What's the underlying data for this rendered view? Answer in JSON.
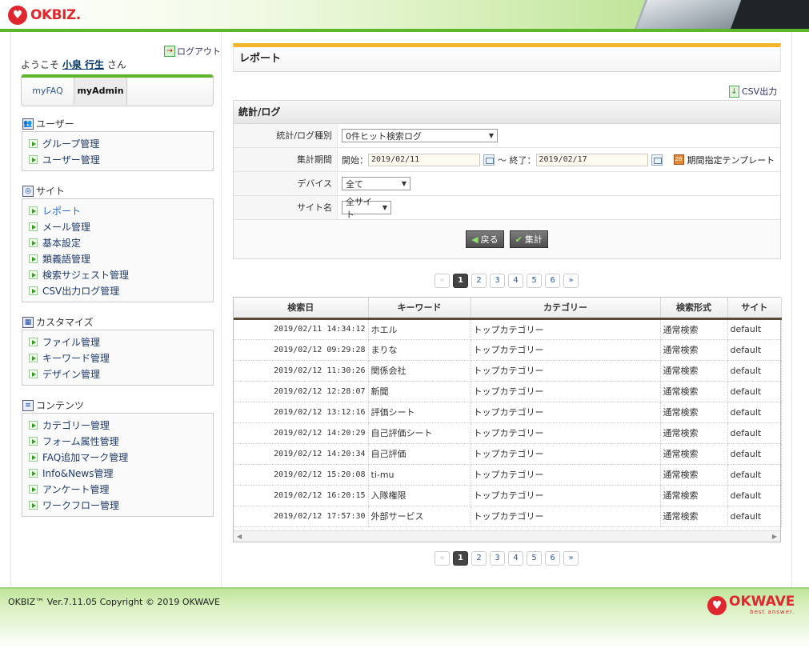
{
  "header": {
    "logo_text": "OKBIZ."
  },
  "sidebar": {
    "logout_label": "ログアウト",
    "welcome_prefix": "ようこそ ",
    "user_name": "小泉 行生",
    "welcome_suffix": " さん",
    "tabs": [
      {
        "label": "myFAQ"
      },
      {
        "label": "myAdmin"
      }
    ],
    "sections": [
      {
        "title": "ユーザー",
        "items": [
          "グループ管理",
          "ユーザー管理"
        ]
      },
      {
        "title": "サイト",
        "items": [
          "レポート",
          "メール管理",
          "基本設定",
          "類義語管理",
          "検索サジェスト管理",
          "CSV出力ログ管理"
        ]
      },
      {
        "title": "カスタマイズ",
        "items": [
          "ファイル管理",
          "キーワード管理",
          "デザイン管理"
        ]
      },
      {
        "title": "コンテンツ",
        "items": [
          "カテゴリー管理",
          "フォーム属性管理",
          "FAQ追加マーク管理",
          "Info&News管理",
          "アンケート管理",
          "ワークフロー管理"
        ]
      }
    ]
  },
  "main": {
    "page_title": "レポート",
    "csv_label": "CSV出力",
    "panel_title": "統計/ログ",
    "form": {
      "type_label": "統計/ログ種別",
      "type_value": "0件ヒット検索ログ",
      "period_label": "集計期間",
      "start_label": "開始：",
      "start_value": "2019/02/11",
      "end_label": "～ 終了：",
      "end_value": "2019/02/17",
      "template_label": "期間指定テンプレート",
      "device_label": "デバイス",
      "device_value": "全て",
      "site_label": "サイト名",
      "site_value": "全サイト"
    },
    "back_button": "戻る",
    "aggregate_button": "集計",
    "pager": {
      "prev": "«",
      "pages": [
        "1",
        "2",
        "3",
        "4",
        "5",
        "6"
      ],
      "next": "»",
      "current": "1"
    },
    "table": {
      "headers": [
        "検索日",
        "キーワード",
        "カテゴリー",
        "検索形式",
        "サイト"
      ],
      "rows": [
        [
          "2019/02/11 14:34:12",
          "ホエル",
          "トップカテゴリー",
          "通常検索",
          "default"
        ],
        [
          "2019/02/12 09:29:28",
          "まりな",
          "トップカテゴリー",
          "通常検索",
          "default"
        ],
        [
          "2019/02/12 11:30:26",
          "関係会社",
          "トップカテゴリー",
          "通常検索",
          "default"
        ],
        [
          "2019/02/12 12:28:07",
          "新聞",
          "トップカテゴリー",
          "通常検索",
          "default"
        ],
        [
          "2019/02/12 13:12:16",
          "評価シート",
          "トップカテゴリー",
          "通常検索",
          "default"
        ],
        [
          "2019/02/12 14:20:29",
          "自己評価シート",
          "トップカテゴリー",
          "通常検索",
          "default"
        ],
        [
          "2019/02/12 14:20:34",
          "自己評価",
          "トップカテゴリー",
          "通常検索",
          "default"
        ],
        [
          "2019/02/12 15:20:08",
          "ti-mu",
          "トップカテゴリー",
          "通常検索",
          "default"
        ],
        [
          "2019/02/12 16:20:15",
          "入隊権限",
          "トップカテゴリー",
          "通常検索",
          "default"
        ],
        [
          "2019/02/12 17:57:30",
          "外部サービス",
          "トップカテゴリー",
          "通常検索",
          "default"
        ]
      ]
    }
  },
  "footer": {
    "copyright": "OKBIZ™ Ver.7.11.05 Copyright © 2019 OKWAVE",
    "logo_text": "OKWAVE",
    "logo_tagline": "best answer."
  }
}
